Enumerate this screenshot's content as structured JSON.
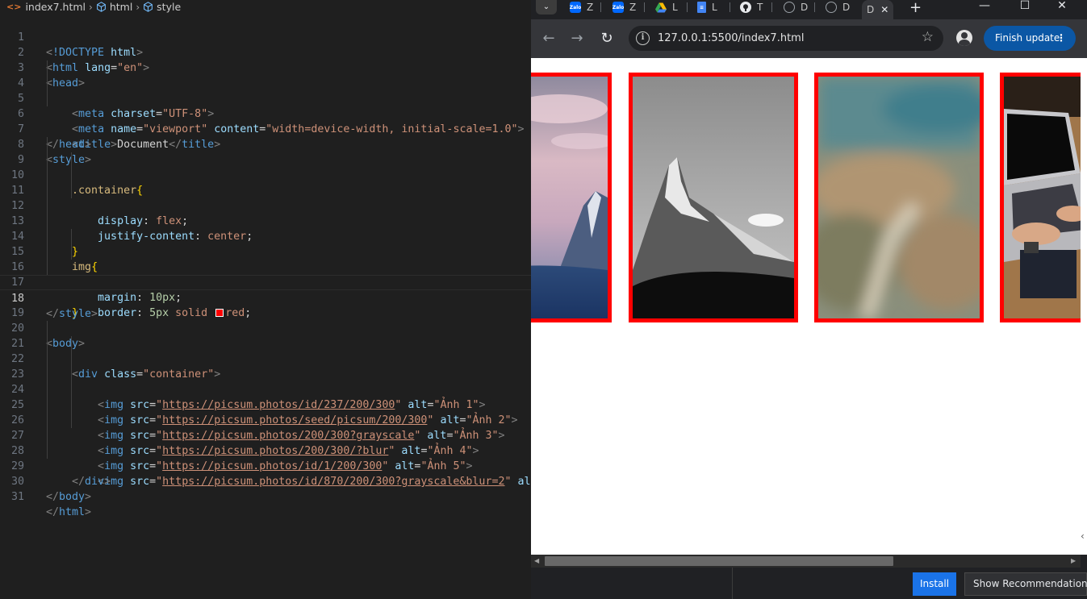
{
  "editor": {
    "breadcrumb": [
      "index7.html",
      "html",
      "style"
    ],
    "lines": [
      {
        "n": "1"
      },
      {
        "n": "2"
      },
      {
        "n": "3"
      },
      {
        "n": "4"
      },
      {
        "n": "5"
      },
      {
        "n": "6"
      },
      {
        "n": "7"
      },
      {
        "n": "8"
      },
      {
        "n": "9"
      },
      {
        "n": "10"
      },
      {
        "n": "11"
      },
      {
        "n": "12"
      },
      {
        "n": "13"
      },
      {
        "n": "14"
      },
      {
        "n": "15"
      },
      {
        "n": "16"
      },
      {
        "n": "17"
      },
      {
        "n": "18"
      },
      {
        "n": "19"
      },
      {
        "n": "20"
      },
      {
        "n": "21"
      },
      {
        "n": "22"
      },
      {
        "n": "23"
      },
      {
        "n": "24"
      },
      {
        "n": "25"
      },
      {
        "n": "26"
      },
      {
        "n": "27"
      },
      {
        "n": "28"
      },
      {
        "n": "29"
      },
      {
        "n": "30"
      },
      {
        "n": "31"
      }
    ],
    "code": {
      "l1_doctype": "!DOCTYPE",
      "l1_html": "html",
      "l2_tag": "html",
      "l2_attr": "lang",
      "l2_val": "\"en\"",
      "l3_tag": "head",
      "l4_tag": "meta",
      "l4_attr": "charset",
      "l4_val": "\"UTF-8\"",
      "l5_tag": "meta",
      "l5_attr1": "name",
      "l5_val1": "\"viewport\"",
      "l5_attr2": "content",
      "l5_val2": "\"width=device-width, initial-scale=1.0\"",
      "l6_tag": "title",
      "l6_text": "Document",
      "l6_close": "title",
      "l7_tag": "head",
      "l8_tag": "style",
      "l9_sel": ".container",
      "l10_prop": "display",
      "l10_val": "flex",
      "l11_prop": "justify-content",
      "l11_val": "center",
      "l14_sel": "img",
      "l15_prop": "margin",
      "l15_val": "10px",
      "l16_prop": "border",
      "l16_val1": "5px",
      "l16_val2": "solid",
      "l16_val3": "red",
      "l18_tag": "style",
      "l20_tag": "body",
      "l21_tag": "div",
      "l21_attr": "class",
      "l21_val": "\"container\"",
      "img_tag": "img",
      "src_attr": "src",
      "alt_attr": "alt",
      "l22_url": "https://picsum.photos/id/237/200/300",
      "l22_alt": "\"Ảnh 1\"",
      "l23_url": "https://picsum.photos/seed/picsum/200/300",
      "l23_alt": "\"Ảnh 2\"",
      "l24_url": "https://picsum.photos/200/300?grayscale",
      "l24_alt": "\"Ảnh 3\"",
      "l25_url": "https://picsum.photos/200/300/?blur",
      "l25_alt": "\"Ảnh 4\"",
      "l26_url": "https://picsum.photos/id/1/200/300",
      "l26_alt": "\"Ảnh 5\"",
      "l27_url": "https://picsum.photos/id/870/200/300?grayscale&blur=2",
      "l27_alt": "\"",
      "l28_tag": "div",
      "l30_tag": "body",
      "l31_tag": "html"
    }
  },
  "browser": {
    "tabs": [
      {
        "icon": "zalo-icon",
        "label": "Z"
      },
      {
        "icon": "zalo-icon",
        "label": "Z"
      },
      {
        "icon": "google-drive-icon",
        "label": "L"
      },
      {
        "icon": "google-docs-icon",
        "label": "L"
      },
      {
        "icon": "github-icon",
        "label": "T"
      },
      {
        "icon": "globe-icon",
        "label": "D"
      },
      {
        "icon": "globe-icon",
        "label": "D"
      },
      {
        "icon": "",
        "label": "D"
      }
    ],
    "url": "127.0.0.1:5500/index7.html",
    "update_button": "Finish update",
    "install_button": "Install",
    "recommendations_button": "Show Recommendations"
  }
}
